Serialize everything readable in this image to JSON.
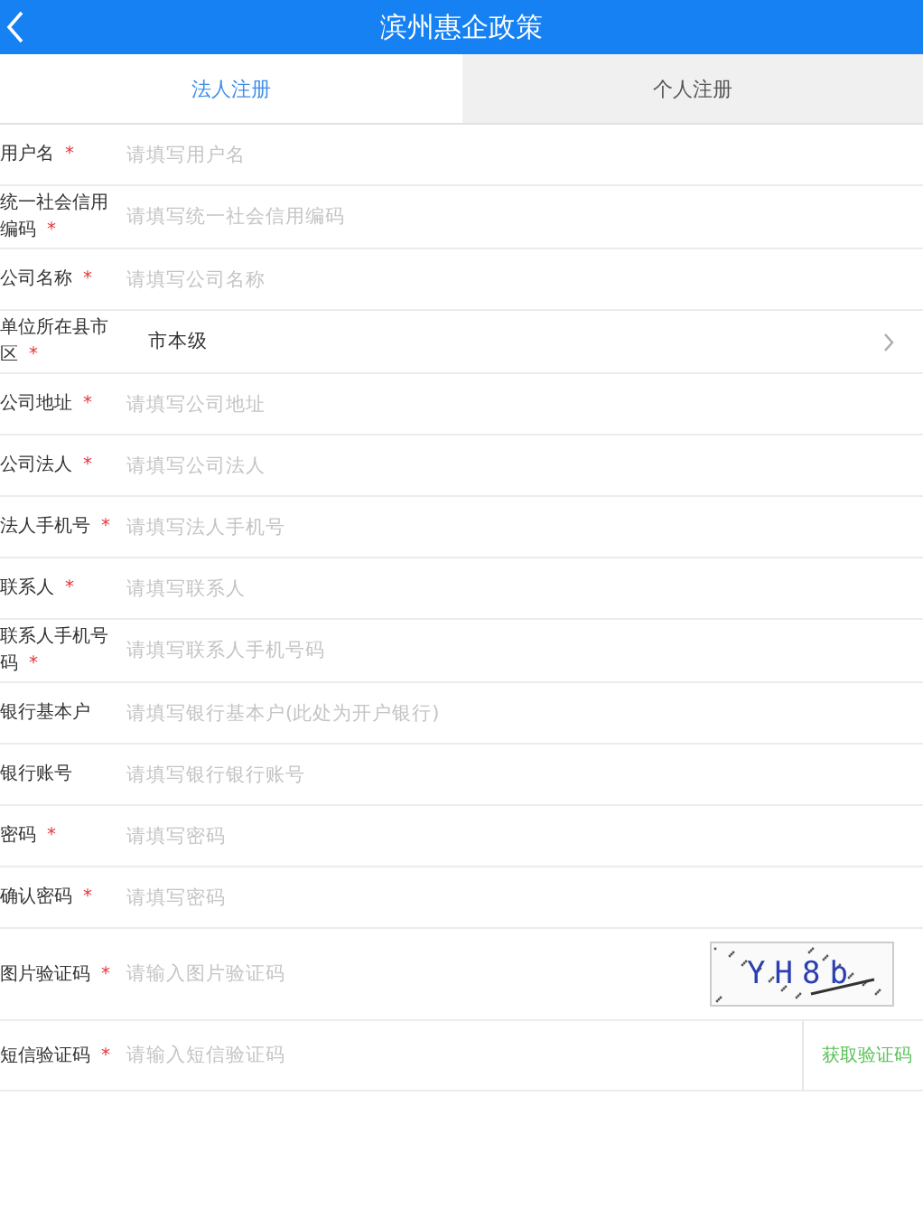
{
  "header": {
    "title": "滨州惠企政策"
  },
  "tabs": [
    {
      "label": "法人注册",
      "selected": true
    },
    {
      "label": "个人注册",
      "selected": false
    }
  ],
  "fields": [
    {
      "kind": "input",
      "label": "用户名",
      "required_mark": "*",
      "placeholder": "请填写用户名"
    },
    {
      "kind": "input",
      "label": "统一社会信用编码",
      "required_mark": "*",
      "placeholder": "请填写统一社会信用编码"
    },
    {
      "kind": "input",
      "label": "公司名称",
      "required_mark": "*",
      "placeholder": "请填写公司名称"
    },
    {
      "kind": "select",
      "label": "单位所在县市区",
      "required_mark": "*",
      "value": "市本级"
    },
    {
      "kind": "input",
      "label": "公司地址",
      "required_mark": "*",
      "placeholder": "请填写公司地址"
    },
    {
      "kind": "input",
      "label": "公司法人",
      "required_mark": "*",
      "placeholder": "请填写公司法人"
    },
    {
      "kind": "input",
      "label": "法人手机号",
      "required_mark": "*",
      "placeholder": "请填写法人手机号"
    },
    {
      "kind": "input",
      "label": "联系人",
      "required_mark": "*",
      "placeholder": "请填写联系人"
    },
    {
      "kind": "input",
      "label": "联系人手机号码",
      "required_mark": "*",
      "placeholder": "请填写联系人手机号码"
    },
    {
      "kind": "input",
      "label": "银行基本户",
      "placeholder": "请填写银行基本户(此处为开户银行)"
    },
    {
      "kind": "input",
      "label": "银行账号",
      "placeholder": "请填写银行银行账号"
    },
    {
      "kind": "input",
      "label": "密码",
      "required_mark": "*",
      "placeholder": "请填写密码"
    },
    {
      "kind": "input",
      "label": "确认密码",
      "required_mark": "*",
      "placeholder": "请填写密码"
    },
    {
      "kind": "captcha",
      "label": "图片验证码",
      "required_mark": "*",
      "placeholder": "请输入图片验证码",
      "captcha_text": "YH8b"
    },
    {
      "kind": "sms",
      "label": "短信验证码",
      "required_mark": "*",
      "placeholder": "请输入短信验证码",
      "button": "获取验证码"
    }
  ]
}
